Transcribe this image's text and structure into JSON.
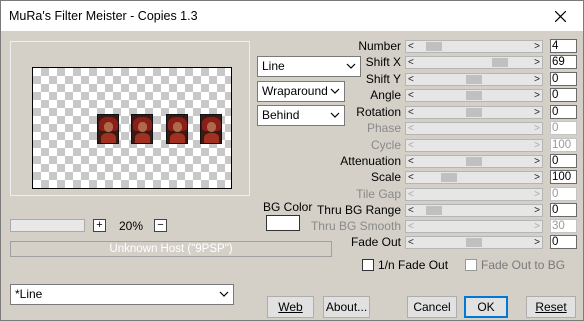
{
  "window": {
    "title": "MuRa's Filter Meister - Copies 1.3"
  },
  "preview": {
    "zoom_value": "20%",
    "zoom_minus": "−",
    "zoom_plus": "+",
    "host_text": "Unknown Host (\"9PSP\")"
  },
  "combos": {
    "mode": "Line",
    "edge": "Wraparound",
    "order": "Behind"
  },
  "bg_color": {
    "label": "BG Color",
    "value": "#ffffff"
  },
  "params": [
    {
      "label": "Number",
      "value": "4",
      "enabled": true,
      "level": 0.1
    },
    {
      "label": "Shift X",
      "value": "69",
      "enabled": true,
      "level": 0.76
    },
    {
      "label": "Shift Y",
      "value": "0",
      "enabled": true,
      "level": 0.5
    },
    {
      "label": "Angle",
      "value": "0",
      "enabled": true,
      "level": 0.5
    },
    {
      "label": "Rotation",
      "value": "0",
      "enabled": true,
      "level": 0.5
    },
    {
      "label": "Phase",
      "value": "0",
      "enabled": false,
      "level": 0
    },
    {
      "label": "Cycle",
      "value": "100",
      "enabled": false,
      "level": 0
    },
    {
      "label": "Attenuation",
      "value": "0",
      "enabled": true,
      "level": 0.5
    },
    {
      "label": "Scale",
      "value": "100",
      "enabled": true,
      "level": 0.25
    },
    {
      "label": "Tile Gap",
      "value": "0",
      "enabled": false,
      "level": 0
    },
    {
      "label": "Thru BG Range",
      "value": "0",
      "enabled": true,
      "level": 0.1
    },
    {
      "label": "Thru BG Smooth",
      "value": "30",
      "enabled": false,
      "level": 0
    },
    {
      "label": "Fade Out",
      "value": "0",
      "enabled": true,
      "level": 0.5
    }
  ],
  "checks": {
    "fade_1n": "1/n Fade Out",
    "fade_bg": "Fade Out to BG"
  },
  "preset_combo": "*Line",
  "buttons": {
    "web": "Web",
    "about": "About...",
    "cancel": "Cancel",
    "ok": "OK",
    "reset": "Reset"
  },
  "colors": {
    "window_bg": "#d4d0c8",
    "focus": "#0078d7"
  },
  "icons": {
    "close": "close-icon",
    "dropdown": "chevron-down-icon"
  }
}
